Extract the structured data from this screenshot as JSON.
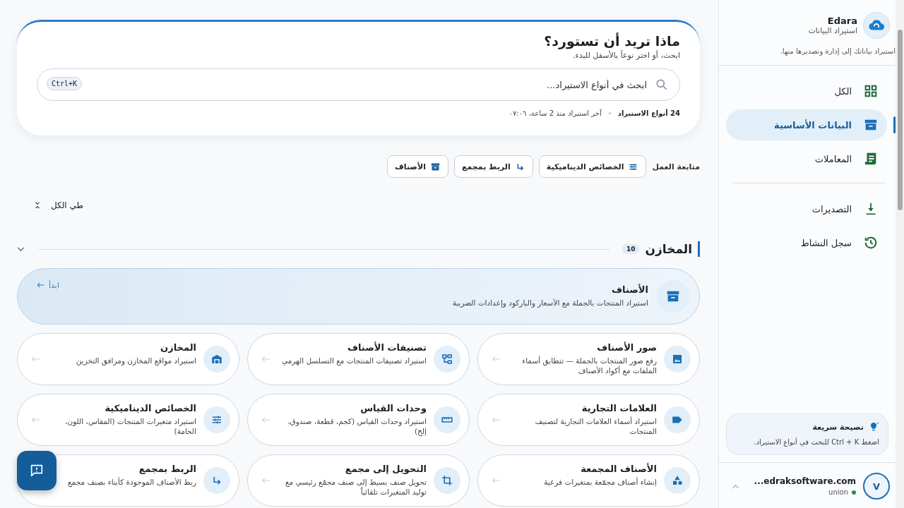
{
  "sidebar": {
    "brand": {
      "name": "Edara",
      "subtitle": "استيراد البيانات"
    },
    "description": "استيراد بياناتك إلى إدارة وتصديرها منها.",
    "nav_groups": [
      {
        "items": [
          {
            "label": "الكل",
            "selected": false
          },
          {
            "label": "البيانات الأساسية",
            "selected": true
          },
          {
            "label": "المعاملات",
            "selected": false
          }
        ]
      },
      {
        "items": [
          {
            "label": "التصديرات",
            "selected": false
          },
          {
            "label": "سجل النشاط",
            "selected": false
          }
        ]
      }
    ],
    "tip": {
      "title": "نصيحة سريعة",
      "text": "اضغط Ctrl + K للبحث في أنواع الاستيراد."
    },
    "user": {
      "avatar": "V",
      "email": "...edraksoftware.com",
      "company": "union"
    }
  },
  "header": {
    "title": "ماذا تريد أن تستورد؟",
    "subtitle": "ابحث، أو اختر نوعاً بالأسفل للبدء.",
    "search": {
      "placeholder": "ابحث في أنواع الاستيراد...",
      "shortcut": "Ctrl+K"
    },
    "count": "24 أنواع الاستيراد",
    "last_import": "آخر استيراد منذ 2 ساعة، ٠٧:٠٦"
  },
  "workflow": {
    "label": "متابعة العمل",
    "chips": [
      "الخصائص الديناميكية",
      "الربط بمجمع",
      "الأصناف"
    ]
  },
  "collapse_all": "طي الكل",
  "section": {
    "title": "المخازن",
    "count": "10",
    "expanded": true,
    "featured": {
      "title": "الأصناف",
      "description": "استيراد المنتجات بالجملة مع الأسعار والباركود وإعدادات الضريبة",
      "action": "ابدأ"
    },
    "cards": [
      {
        "title": "صور الأصناف",
        "description": "رفع صور المنتجات بالجملة — تتطابق أسماء الملفات مع أكواد الأصناف"
      },
      {
        "title": "تصنيفات الأصناف",
        "description": "استيراد تصنيفات المنتجات مع التسلسل الهرمي"
      },
      {
        "title": "المخازن",
        "description": "استيراد مواقع المخازن ومرافق التخزين"
      },
      {
        "title": "العلامات التجارية",
        "description": "استيراد أسماء العلامات التجارية لتصنيف المنتجات"
      },
      {
        "title": "وحدات القياس",
        "description": "استيراد وحدات القياس (كجم، قطعة، صندوق، إلخ)"
      },
      {
        "title": "الخصائص الديناميكية",
        "description": "استيراد متغيرات المنتجات (المقاس، اللون، الخامة)"
      },
      {
        "title": "الأصناف المجمعة",
        "description": "إنشاء أصناف مجمّعة بمتغيرات فرعية"
      },
      {
        "title": "التحويل إلى مجمع",
        "description": "تحويل صنف بسيط إلى صنف مجمّع رئيسي مع توليد المتغيرات تلقائياً"
      },
      {
        "title": "الربط بمجمع",
        "description": "ربط الأصناف الموجودة كأبناء بصنف مجمع"
      }
    ]
  }
}
